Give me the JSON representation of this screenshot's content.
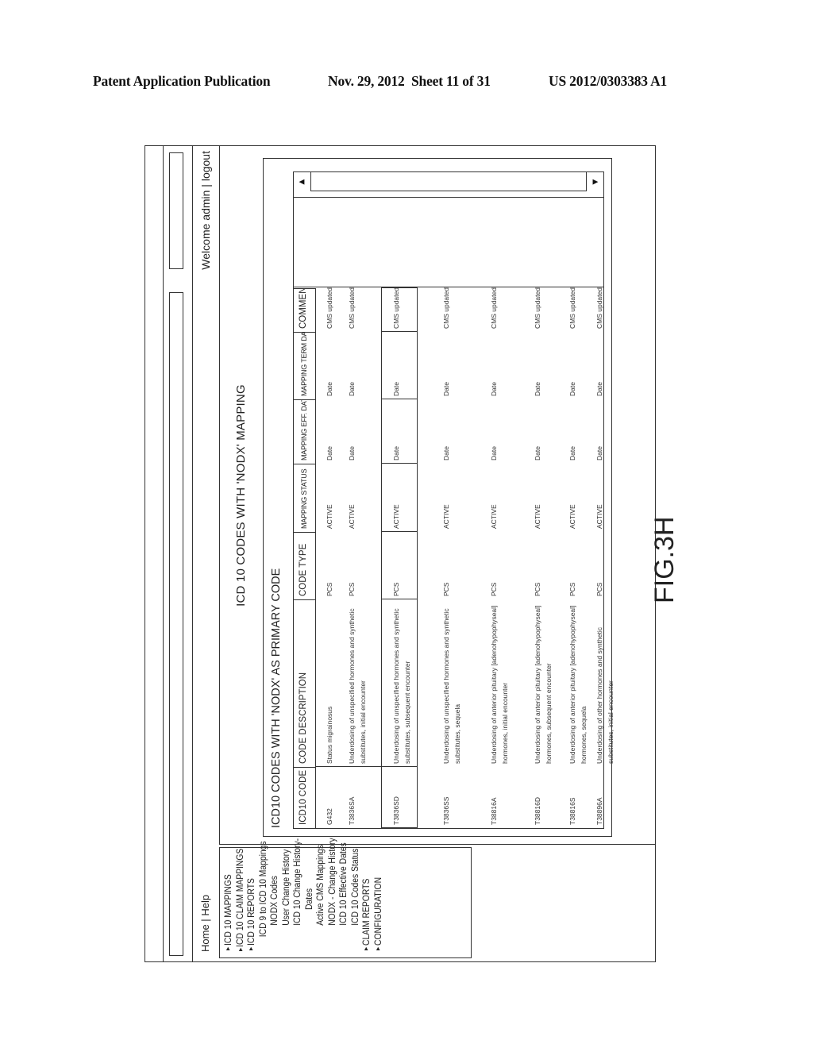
{
  "publication": {
    "title": "Patent Application Publication",
    "date": "Nov. 29, 2012",
    "sheet": "Sheet 11 of 31",
    "number": "US 2012/0303383 A1"
  },
  "figure_label": "FIG.3H",
  "header": {
    "home": "Home",
    "separator": "|",
    "help": "Help",
    "welcome": "Welcome admin",
    "logout": "logout"
  },
  "sidebar": {
    "items": [
      {
        "label": "ICD 10 MAPPINGS",
        "arrow": "▲",
        "level": 0
      },
      {
        "label": "ICD 10 CLAIM MAPPINGS",
        "arrow": "▲",
        "level": 0
      },
      {
        "label": "ICD 10 REPORTS",
        "arrow": "▲",
        "level": 0
      },
      {
        "label": "ICD 9 to ICD 10 Mappings",
        "arrow": "",
        "level": 1
      },
      {
        "label": "NODX Codes",
        "arrow": "",
        "level": 2
      },
      {
        "label": "User Change History",
        "arrow": "",
        "level": 2
      },
      {
        "label": "ICD 10 Change History-",
        "arrow": "",
        "level": 2
      },
      {
        "label": "Dates",
        "arrow": "",
        "level": 3
      },
      {
        "label": "Active CMS Mappings",
        "arrow": "",
        "level": 2
      },
      {
        "label": "NODX - Change History",
        "arrow": "",
        "level": 2
      },
      {
        "label": "ICD 10 Effective Dates",
        "arrow": "",
        "level": 2
      },
      {
        "label": "ICD 10 Codes Status",
        "arrow": "",
        "level": 2
      },
      {
        "label": "CLAIM REPORTS",
        "arrow": "▲",
        "level": 0
      },
      {
        "label": "CONFIGURATION",
        "arrow": "▲",
        "level": 0
      }
    ]
  },
  "page_title": "ICD 10 CODES WITH 'NODX' MAPPING",
  "panel": {
    "title": "ICD10 CODES WITH 'NODX' AS PRIMARY CODE",
    "columns": [
      "ICD10 CODE",
      "CODE DESCRIPTION",
      "CODE TYPE",
      "MAPPING STATUS",
      "MAPPING EFF. DATE",
      "MAPPING TERM DATE",
      "COMMENTS"
    ],
    "rows": [
      {
        "code": "G432",
        "description": "Status migrainosus",
        "type": "PCS",
        "status": "ACTIVE",
        "eff_date": "Date",
        "term_date": "Date",
        "comments": "CMS updated"
      },
      {
        "code": "T3836SA",
        "description": "Underdosing of unspecified hormones and synthetic substitutes, initial encounter",
        "type": "PCS",
        "status": "ACTIVE",
        "eff_date": "Date",
        "term_date": "Date",
        "comments": "CMS updated"
      },
      {
        "code": "T3836SD",
        "description": "Underdosing of unspecified hormones and synthetic substitutes, subsequent encounter",
        "type": "PCS",
        "status": "ACTIVE",
        "eff_date": "Date",
        "term_date": "Date",
        "comments": "CMS updated"
      },
      {
        "code": "T3836SS",
        "description": "Underdosing of unspecified hormones and synthetic substitutes, sequela",
        "type": "PCS",
        "status": "ACTIVE",
        "eff_date": "Date",
        "term_date": "Date",
        "comments": "CMS updated"
      },
      {
        "code": "T38816A",
        "description": "Underdosing of anterior pituitary [adenohypophyseal] hormones, initial encounter",
        "type": "PCS",
        "status": "ACTIVE",
        "eff_date": "Date",
        "term_date": "Date",
        "comments": "CMS updated"
      },
      {
        "code": "T38816D",
        "description": "Underdosing of anterior pituitary [adenohypophyseal] hormones, subsequent encounter",
        "type": "PCS",
        "status": "ACTIVE",
        "eff_date": "Date",
        "term_date": "Date",
        "comments": "CMS updated"
      },
      {
        "code": "T38816S",
        "description": "Underdosing of anterior pituitary [adenohypophyseal] hormones, sequela",
        "type": "PCS",
        "status": "ACTIVE",
        "eff_date": "Date",
        "term_date": "Date",
        "comments": "CMS updated"
      },
      {
        "code": "T38896A",
        "description": "Underdosing of other hormones and synthetic substitutes, initial encounter",
        "type": "PCS",
        "status": "ACTIVE",
        "eff_date": "Date",
        "term_date": "Date",
        "comments": "CMS updated"
      }
    ],
    "scroll_left_icon": "◀",
    "scroll_right_icon": "▶"
  }
}
